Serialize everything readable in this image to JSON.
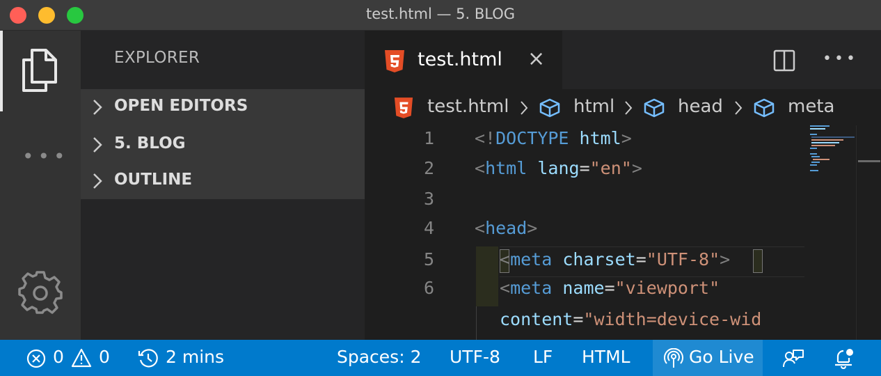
{
  "window": {
    "title": "test.html — 5. BLOG"
  },
  "sidebar": {
    "title": "EXPLORER",
    "sections": [
      {
        "label": "OPEN EDITORS"
      },
      {
        "label": "5. BLOG"
      },
      {
        "label": "OUTLINE"
      }
    ]
  },
  "editor": {
    "tab": {
      "label": "test.html",
      "close": "×"
    },
    "breadcrumb": [
      "test.html",
      "html",
      "head",
      "meta"
    ],
    "line_numbers": [
      "1",
      "2",
      "3",
      "4",
      "5",
      "6"
    ],
    "code": {
      "l1": [
        "<!",
        "DOCTYPE",
        " ",
        "html",
        ">"
      ],
      "l2": [
        "<",
        "html",
        " ",
        "lang",
        "=",
        "\"en\"",
        ">"
      ],
      "l4": [
        "<",
        "head",
        ">"
      ],
      "l5": [
        "<",
        "meta",
        " ",
        "charset",
        "=",
        "\"UTF-8\"",
        ">"
      ],
      "l6": [
        "<",
        "meta",
        " ",
        "name",
        "=",
        "\"viewport\""
      ],
      "l6b": [
        "content",
        "=",
        "\"width=device-wid"
      ]
    }
  },
  "statusbar": {
    "errors": "0",
    "warnings": "0",
    "time": "2 mins",
    "spaces": "Spaces: 2",
    "encoding": "UTF-8",
    "eol": "LF",
    "language": "HTML",
    "golive": "Go Live"
  },
  "colors": {
    "statusbar": "#007acc",
    "html5_icon": "#e44d26",
    "tag": "#569cd6",
    "attribute": "#9cdcfe",
    "string": "#ce9178"
  }
}
